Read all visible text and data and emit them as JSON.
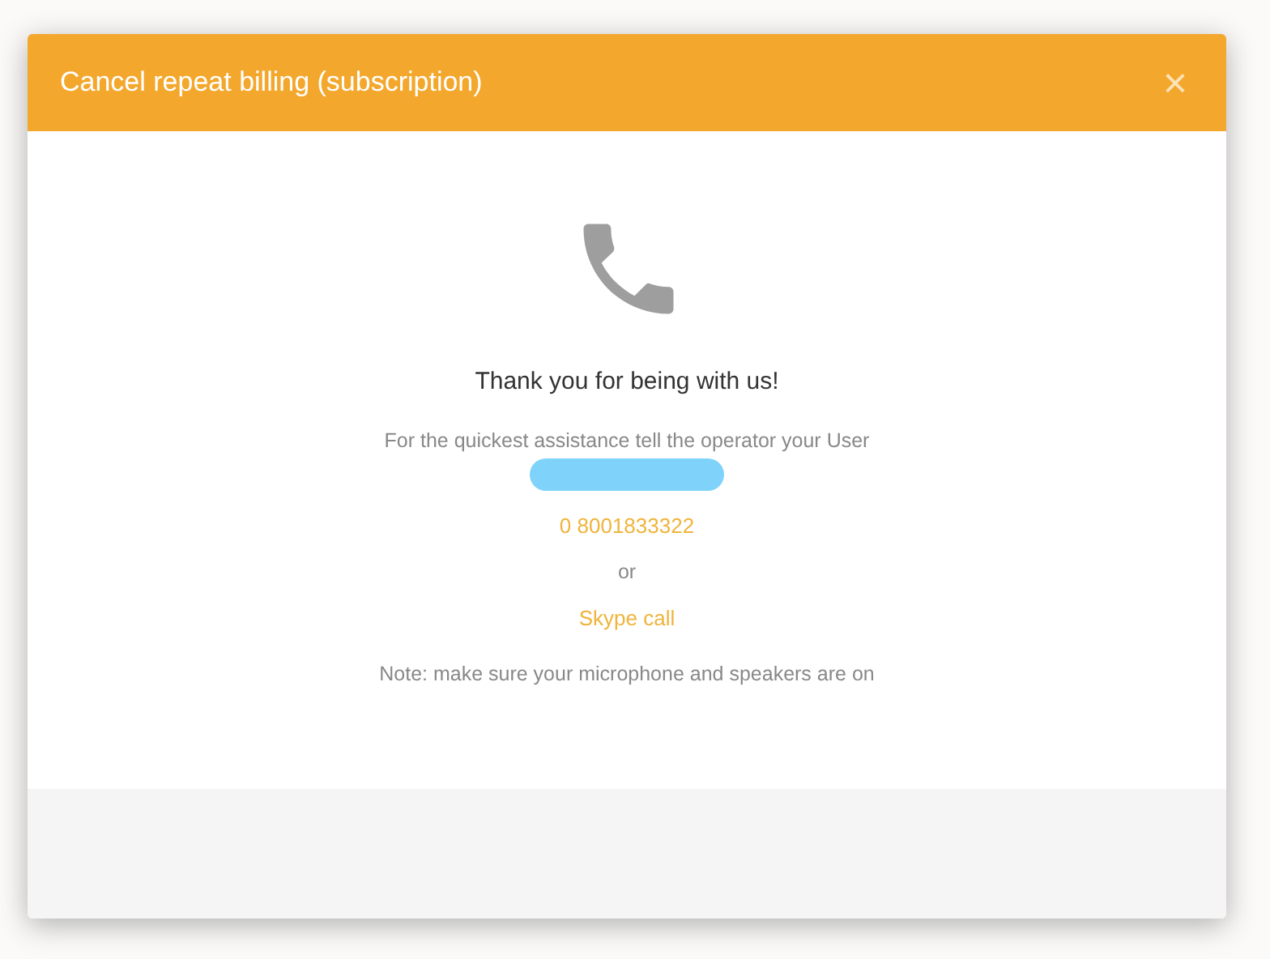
{
  "dialog": {
    "title": "Cancel repeat billing (subscription)",
    "close": "×",
    "heading": "Thank you for being with us!",
    "instruction": "For the quickest assistance tell the operator your User",
    "phone": "0 8001833322",
    "separator": "or",
    "skype_link": "Skype call",
    "note": "Note: make sure your microphone and speakers are on"
  }
}
